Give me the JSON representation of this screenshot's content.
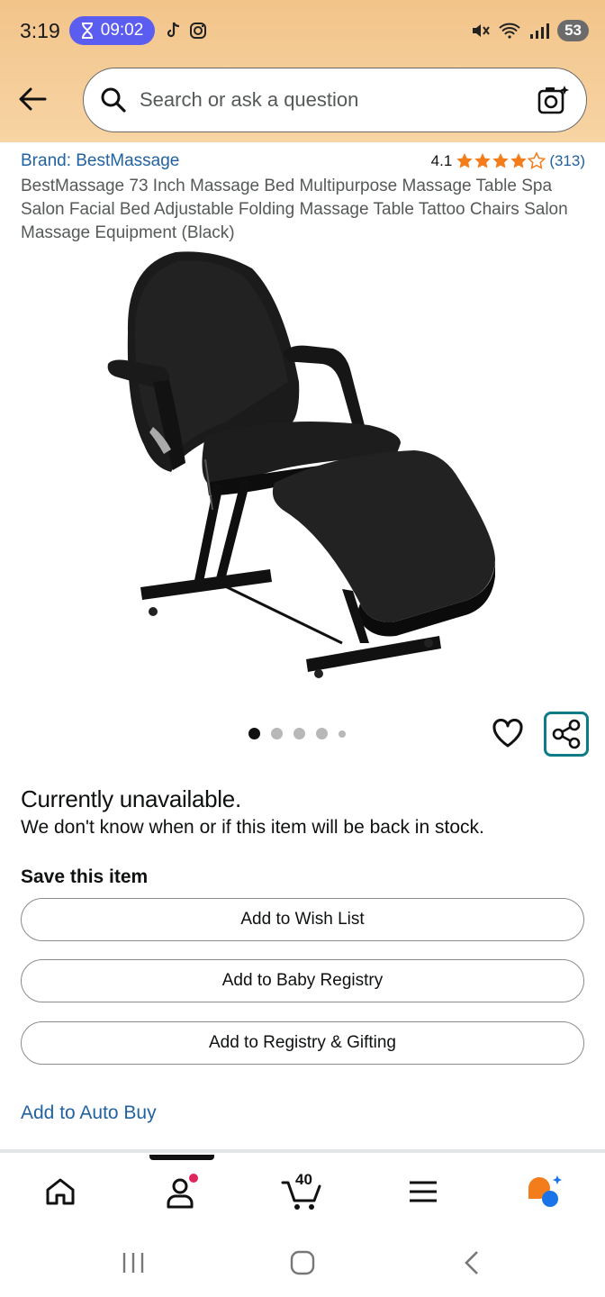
{
  "status_bar": {
    "time": "3:19",
    "timer": "09:02",
    "battery": "53"
  },
  "search": {
    "placeholder": "Search or ask a question"
  },
  "product": {
    "brand": "Brand: BestMassage",
    "rating_value": "4.1",
    "rating_stars": 4.1,
    "rating_count": "(313)",
    "title": "BestMassage 73 Inch Massage Bed Multipurpose Massage Table Spa Salon Facial Bed Adjustable Folding Massage Table Tattoo Chairs Salon Massage Equipment (Black)",
    "image_count": 5,
    "active_image_index": 0
  },
  "availability": {
    "heading": "Currently unavailable.",
    "message": "We don't know when or if this item will be back in stock."
  },
  "save_section": {
    "heading": "Save this item",
    "buttons": [
      "Add to Wish List",
      "Add to Baby Registry",
      "Add to Registry & Gifting"
    ],
    "auto_buy_link": "Add to Auto Buy"
  },
  "bottom_nav": {
    "items": [
      "home-icon",
      "account-icon",
      "cart-icon",
      "menu-icon",
      "rufus-icon"
    ],
    "cart_count": "40",
    "active": "account-icon"
  },
  "colors": {
    "header_bg": "#f2c48a",
    "link": "#2162a1",
    "star": "#f27d1a",
    "share_border": "#0e7c86",
    "timer_pill": "#5b5cf0"
  }
}
